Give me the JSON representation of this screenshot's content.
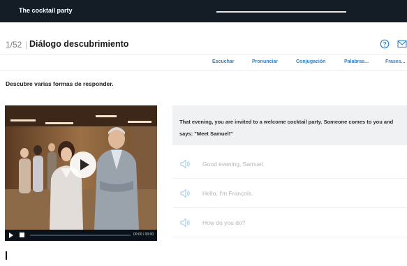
{
  "app": {
    "title": "The cocktail party"
  },
  "header": {
    "counter": "1/52",
    "separator": "|",
    "lesson_title": "Diálogo descubrimiento",
    "help_icon": "question-circle-icon",
    "mail_icon": "envelope-icon"
  },
  "tabs": [
    {
      "label": "Escuchar"
    },
    {
      "label": "Pronunciar"
    },
    {
      "label": "Conjugación"
    },
    {
      "label": "Palabras..."
    },
    {
      "label": "Frases..."
    }
  ],
  "instruction": "Descubre varias formas de responder.",
  "video": {
    "time_label": "00:00 / 00:00",
    "play_icon": "play-icon",
    "stop_icon": "stop-icon"
  },
  "context": {
    "text": "That evening, you are invited to a welcome cocktail party. Someone comes to you and says: \"Meet Samuel!\""
  },
  "responses": [
    {
      "text": "Good evening, Samuel.",
      "icon": "speaker-icon"
    },
    {
      "text": "Hello, I'm François.",
      "icon": "speaker-icon"
    },
    {
      "text": "How do you do?",
      "icon": "speaker-icon"
    }
  ],
  "colors": {
    "topbar": "#141d26",
    "accent": "#2d7fc9",
    "response_text": "#b5b5b5",
    "context_bg": "#f0f1f3"
  }
}
